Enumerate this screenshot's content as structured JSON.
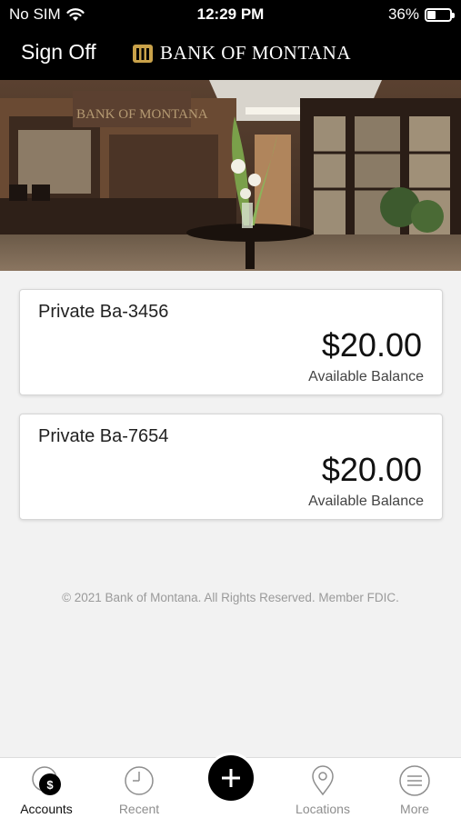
{
  "status_bar": {
    "carrier": "No SIM",
    "time": "12:29 PM",
    "battery_percent": "36%",
    "battery_level": 0.36
  },
  "header": {
    "sign_off_label": "Sign Off",
    "brand_name": "Bank of Montana",
    "brand_color": "#c9a24a"
  },
  "accounts": [
    {
      "name": "Private Ba-3456",
      "balance": "$20.00",
      "balance_label": "Available Balance"
    },
    {
      "name": "Private Ba-7654",
      "balance": "$20.00",
      "balance_label": "Available Balance"
    }
  ],
  "footer": {
    "copyright": "© 2021 Bank of Montana. All Rights Reserved. Member FDIC."
  },
  "tab_bar": {
    "tabs": [
      {
        "label": "Accounts",
        "icon": "dollar-circle-icon",
        "active": true
      },
      {
        "label": "Recent",
        "icon": "clock-icon",
        "active": false
      },
      {
        "label": "Locations",
        "icon": "map-pin-icon",
        "active": false
      },
      {
        "label": "More",
        "icon": "menu-lines-icon",
        "active": false
      }
    ],
    "fab_icon": "plus-icon"
  }
}
